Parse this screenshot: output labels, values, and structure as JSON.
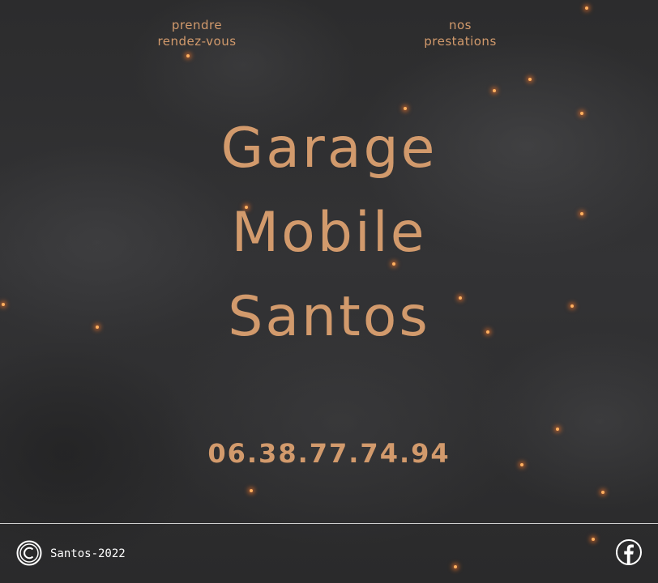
{
  "nav": {
    "rdv_line1": "prendre",
    "rdv_line2": "rendez-vous",
    "prest_line1": "nos",
    "prest_line2": "prestations"
  },
  "hero": {
    "line1": "Garage",
    "line2": "Mobile",
    "line3": "Santos"
  },
  "contact": {
    "phone": "06.38.77.74.94"
  },
  "footer": {
    "copyright": "Santos-2022",
    "copyright_icon": "copyright-icon",
    "social_icon": "facebook-icon"
  },
  "colors": {
    "accent": "#d29a6c",
    "background": "#2a2a2b",
    "footer_text": "#ffffff",
    "ember": "#ffb060"
  }
}
